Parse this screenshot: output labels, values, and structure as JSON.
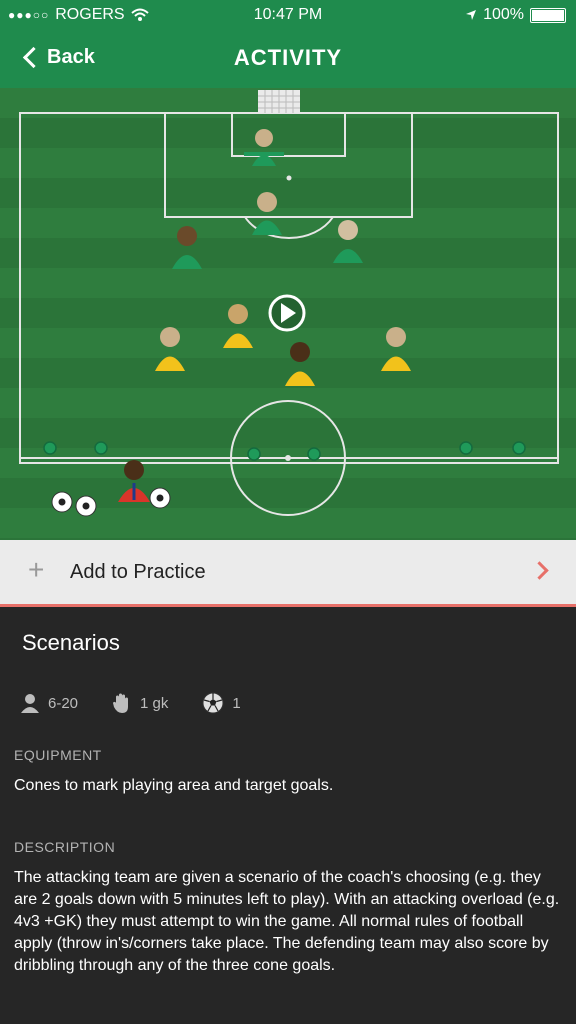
{
  "status": {
    "carrier": "ROGERS",
    "time": "10:47 PM",
    "battery": "100%",
    "battery_level": 1.0,
    "icons": {
      "signal": "signal-dots-icon",
      "wifi": "wifi-icon",
      "location": "location-arrow-icon",
      "battery": "battery-icon"
    }
  },
  "nav": {
    "back_label": "Back",
    "title": "ACTIVITY"
  },
  "field": {
    "colors": {
      "grass_light": "#2f7d3e",
      "grass_dark": "#2a7238",
      "lines": "#e6e6e6",
      "green_team": "#1f9a5a",
      "yellow_team": "#f2c21b",
      "coach": "#d8352a",
      "cone": "#1f9a5a"
    },
    "play_icon": "play-circle-icon"
  },
  "add_to_practice": {
    "label": "Add to Practice",
    "icon": "plus-icon",
    "accent": "#e77069"
  },
  "activity": {
    "title": "Scenarios",
    "players": "6-20",
    "gk": "1 gk",
    "balls": "1",
    "icons": {
      "players": "person-icon",
      "gk": "glove-icon",
      "balls": "soccer-ball-icon"
    }
  },
  "equipment": {
    "heading": "EQUIPMENT",
    "text": "Cones to mark playing area and target goals."
  },
  "description": {
    "heading": "DESCRIPTION",
    "text": "The attacking team are given a scenario of the coach's choosing (e.g. they are 2 goals down with 5 minutes left to play). With an attacking overload (e.g. 4v3 +GK) they must attempt to win the game. All normal rules of football apply (throw in's/corners take place. The defending team may also score by dribbling through any of the three cone goals."
  }
}
